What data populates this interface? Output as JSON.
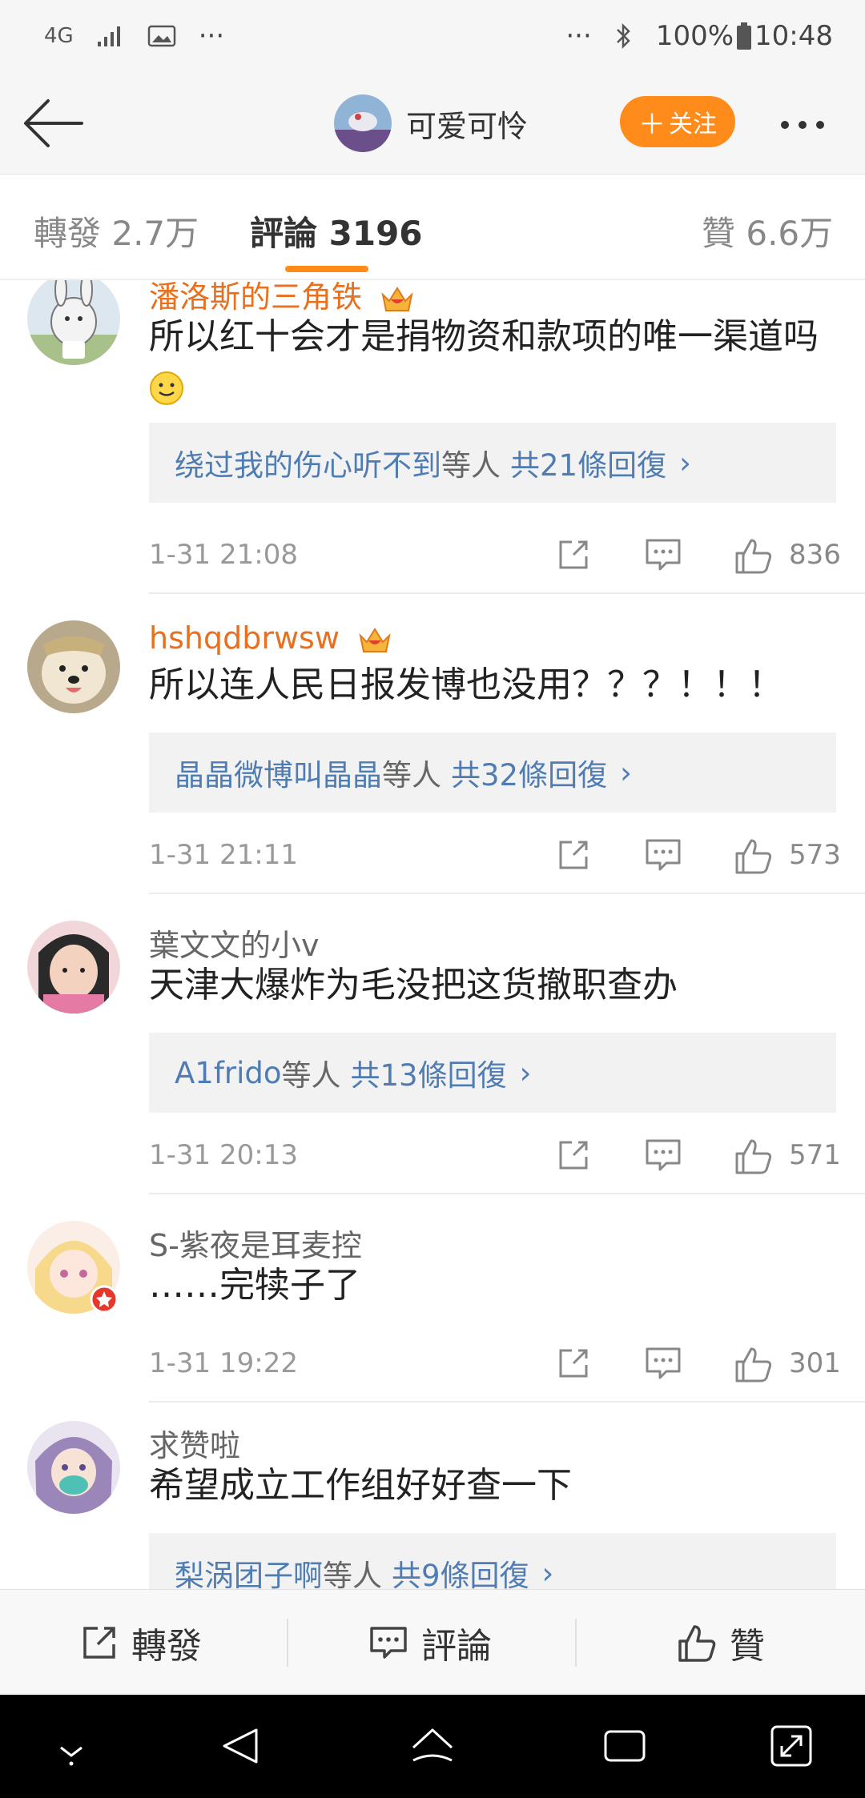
{
  "status_bar": {
    "network": "4G",
    "left_more": "···",
    "right_more": "···",
    "battery": "100%",
    "time": "10:48"
  },
  "header": {
    "username": "可爱可怜",
    "follow_label": "关注"
  },
  "tabs": [
    {
      "label": "轉發 2.7万"
    },
    {
      "label": "評論 3196"
    },
    {
      "label": "贊 6.6万"
    }
  ],
  "comments": [
    {
      "name": "潘洛斯的三角铁",
      "badge": "5",
      "text": "所以红十会才是捐物资和款项的唯一渠道吗",
      "reply_who": "绕过我的伤心听不到",
      "reply_tail": "等人",
      "reply_count": "共21條回復",
      "time": "1-31 21:08",
      "likes": "836"
    },
    {
      "name": "hshqdbrwsw",
      "badge": "6",
      "text": "所以连人民日报发博也没用？？？！！！",
      "reply_who": "晶晶微博叫晶晶",
      "reply_tail": "等人",
      "reply_count": "共32條回復",
      "time": "1-31 21:11",
      "likes": "573"
    },
    {
      "name": "葉文文的小v",
      "text": "天津大爆炸为毛没把这货撤职查办",
      "reply_who": "A1frido",
      "reply_tail": "等人",
      "reply_count": "共13條回復",
      "time": "1-31 20:13",
      "likes": "571"
    },
    {
      "name": "S-紫夜是耳麦控",
      "text": "……完犊子了",
      "time": "1-31 19:22",
      "likes": "301"
    },
    {
      "name": "求赞啦",
      "text": "希望成立工作组好好查一下",
      "reply_who": "梨涡团子啊",
      "reply_tail": "等人",
      "reply_count": "共9條回復"
    }
  ],
  "bottom_bar": {
    "repost": "轉發",
    "comment": "評論",
    "like": "贊"
  },
  "colors": {
    "accent": "#ff8c1a",
    "link": "#4f7db3",
    "vip_name": "#e8701e"
  }
}
